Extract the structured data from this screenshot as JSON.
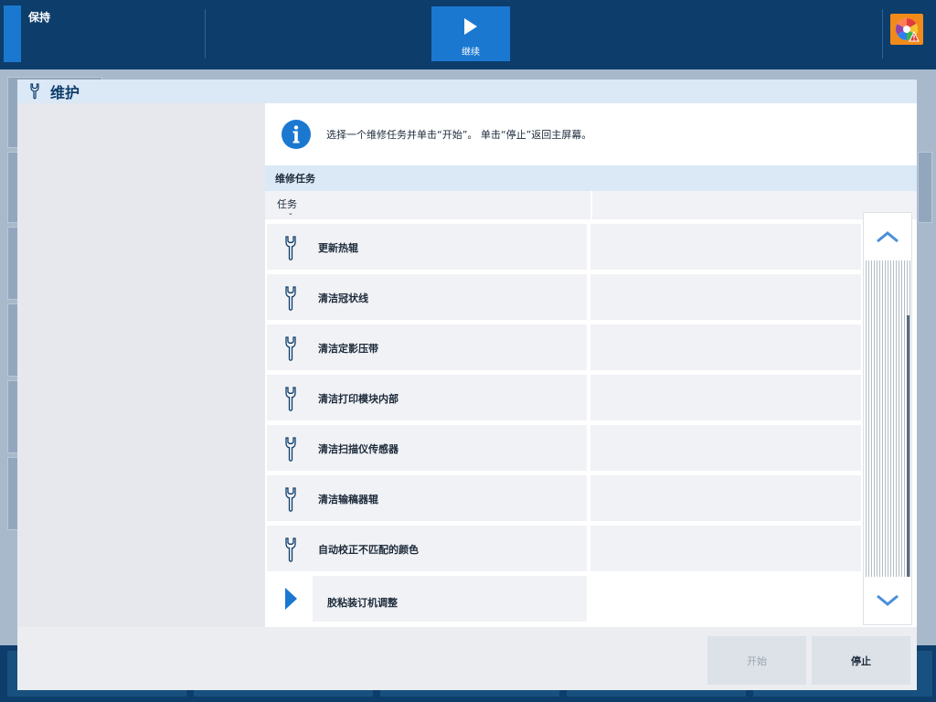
{
  "topbar": {
    "hold_label": "保持",
    "continue_label": "继续"
  },
  "modal": {
    "title": "维护",
    "info_text": "选择一个维修任务并单击“开始”。 单击“停止”返回主屏幕。",
    "section_title": "维修任务",
    "column_header": "任务",
    "tasks": [
      {
        "label": "更新热辊",
        "icon": "wrench-icon"
      },
      {
        "label": "清洁冠状线",
        "icon": "wrench-icon"
      },
      {
        "label": "清洁定影压带",
        "icon": "wrench-icon"
      },
      {
        "label": "清洁打印模块内部",
        "icon": "wrench-icon"
      },
      {
        "label": "清洁扫描仪传感器",
        "icon": "wrench-icon"
      },
      {
        "label": "清洁输稿器辊",
        "icon": "wrench-icon"
      },
      {
        "label": "自动校正不匹配的颜色",
        "icon": "wrench-icon"
      },
      {
        "label": "胶粘装订机调整",
        "icon": "play-arrow-icon",
        "selected": true
      }
    ],
    "start_label": "开始",
    "stop_label": "停止"
  },
  "colors": {
    "navy": "#0d3d6b",
    "accent": "#1b78d0",
    "status_orange": "#f28a1a"
  }
}
